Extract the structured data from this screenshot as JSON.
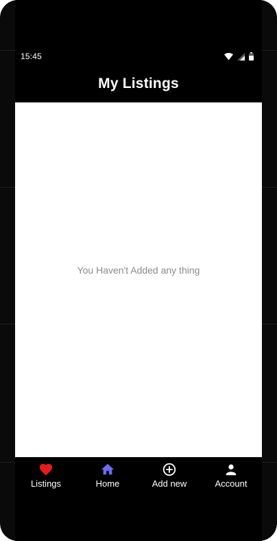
{
  "status_bar": {
    "time": "15:45",
    "icons": [
      "wifi-icon",
      "signal-icon",
      "battery-icon"
    ]
  },
  "app_bar": {
    "title": "My Listings"
  },
  "content": {
    "empty_message": "You Haven't Added any thing"
  },
  "bottom_nav": {
    "items": [
      {
        "label": "Listings",
        "icon": "heart-icon",
        "color": "#e8191f"
      },
      {
        "label": "Home",
        "icon": "home-icon",
        "color": "#6b6bf0"
      },
      {
        "label": "Add new",
        "icon": "add-circle-icon",
        "color": "#ffffff"
      },
      {
        "label": "Account",
        "icon": "person-icon",
        "color": "#ffffff"
      }
    ]
  },
  "colors": {
    "background": "#000000",
    "content_background": "#ffffff",
    "accent_listings": "#e8191f",
    "accent_home": "#6b6bf0",
    "empty_text": "#8a8a8a"
  }
}
